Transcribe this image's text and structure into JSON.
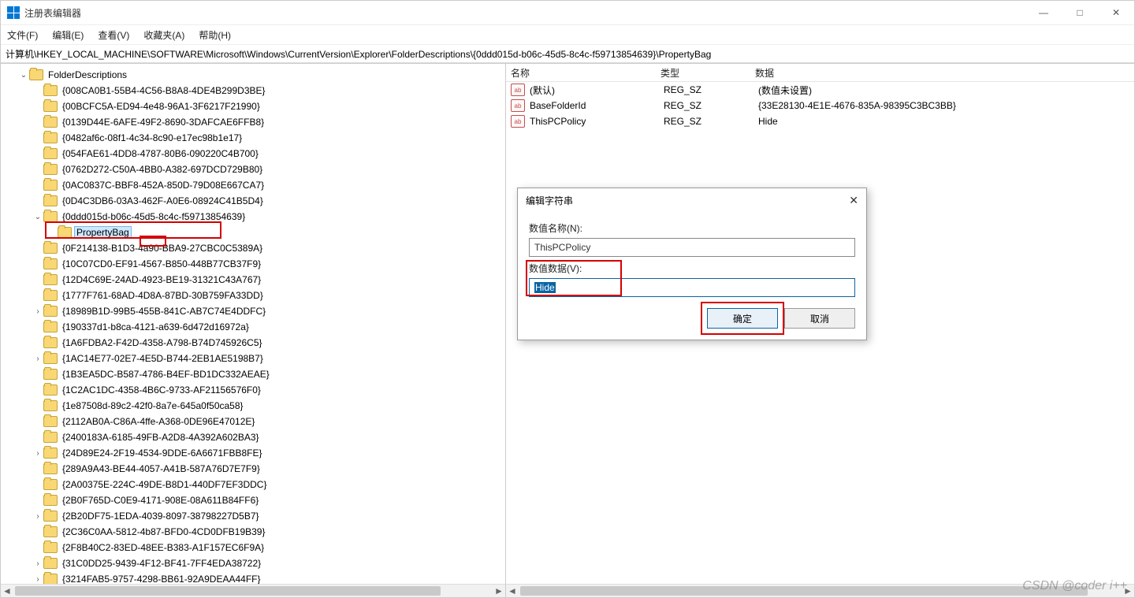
{
  "window": {
    "title": "注册表编辑器",
    "controls": {
      "min": "—",
      "max": "□",
      "close": "✕"
    }
  },
  "menu": {
    "file": "文件(F)",
    "edit": "编辑(E)",
    "view": "查看(V)",
    "fav": "收藏夹(A)",
    "help": "帮助(H)"
  },
  "addressbar": "计算机\\HKEY_LOCAL_MACHINE\\SOFTWARE\\Microsoft\\Windows\\CurrentVersion\\Explorer\\FolderDescriptions\\{0ddd015d-b06c-45d5-8c4c-f59713854639}\\PropertyBag",
  "tree": {
    "root": "FolderDescriptions",
    "expanded": "{0ddd015d-b06c-45d5-8c4c-f59713854639}",
    "selected": "PropertyBag",
    "items": [
      {
        "t": "{008CA0B1-55B4-4C56-B8A8-4DE4B299D3BE}"
      },
      {
        "t": "{00BCFC5A-ED94-4e48-96A1-3F6217F21990}"
      },
      {
        "t": "{0139D44E-6AFE-49F2-8690-3DAFCAE6FFB8}"
      },
      {
        "t": "{0482af6c-08f1-4c34-8c90-e17ec98b1e17}"
      },
      {
        "t": "{054FAE61-4DD8-4787-80B6-090220C4B700}"
      },
      {
        "t": "{0762D272-C50A-4BB0-A382-697DCD729B80}"
      },
      {
        "t": "{0AC0837C-BBF8-452A-850D-79D08E667CA7}"
      },
      {
        "t": "{0D4C3DB6-03A3-462F-A0E6-08924C41B5D4}"
      },
      {
        "t": "{0ddd015d-b06c-45d5-8c4c-f59713854639}",
        "open": true,
        "child": "PropertyBag"
      },
      {
        "t": "{0F214138-B1D3-4a90-BBA9-27CBC0C5389A}"
      },
      {
        "t": "{10C07CD0-EF91-4567-B850-448B77CB37F9}"
      },
      {
        "t": "{12D4C69E-24AD-4923-BE19-31321C43A767}"
      },
      {
        "t": "{1777F761-68AD-4D8A-87BD-30B759FA33DD}"
      },
      {
        "t": "{18989B1D-99B5-455B-841C-AB7C74E4DDFC}",
        "exp": true
      },
      {
        "t": "{190337d1-b8ca-4121-a639-6d472d16972a}"
      },
      {
        "t": "{1A6FDBA2-F42D-4358-A798-B74D745926C5}"
      },
      {
        "t": "{1AC14E77-02E7-4E5D-B744-2EB1AE5198B7}",
        "exp": true
      },
      {
        "t": "{1B3EA5DC-B587-4786-B4EF-BD1DC332AEAE}"
      },
      {
        "t": "{1C2AC1DC-4358-4B6C-9733-AF21156576F0}"
      },
      {
        "t": "{1e87508d-89c2-42f0-8a7e-645a0f50ca58}"
      },
      {
        "t": "{2112AB0A-C86A-4ffe-A368-0DE96E47012E}"
      },
      {
        "t": "{2400183A-6185-49FB-A2D8-4A392A602BA3}"
      },
      {
        "t": "{24D89E24-2F19-4534-9DDE-6A6671FBB8FE}",
        "exp": true
      },
      {
        "t": "{289A9A43-BE44-4057-A41B-587A76D7E7F9}"
      },
      {
        "t": "{2A00375E-224C-49DE-B8D1-440DF7EF3DDC}"
      },
      {
        "t": "{2B0F765D-C0E9-4171-908E-08A611B84FF6}"
      },
      {
        "t": "{2B20DF75-1EDA-4039-8097-38798227D5B7}",
        "exp": true
      },
      {
        "t": "{2C36C0AA-5812-4b87-BFD0-4CD0DFB19B39}"
      },
      {
        "t": "{2F8B40C2-83ED-48EE-B383-A1F157EC6F9A}"
      },
      {
        "t": "{31C0DD25-9439-4F12-BF41-7FF4EDA38722}",
        "exp": true
      },
      {
        "t": "{3214FAB5-9757-4298-BB61-92A9DEAA44FF}",
        "exp": true
      }
    ]
  },
  "columns": {
    "name": "名称",
    "type": "类型",
    "data": "数据"
  },
  "values": [
    {
      "name": "(默认)",
      "type": "REG_SZ",
      "data": "(数值未设置)"
    },
    {
      "name": "BaseFolderId",
      "type": "REG_SZ",
      "data": "{33E28130-4E1E-4676-835A-98395C3BC3BB}"
    },
    {
      "name": "ThisPCPolicy",
      "type": "REG_SZ",
      "data": "Hide"
    }
  ],
  "dialog": {
    "title": "编辑字符串",
    "name_label": "数值名称(N):",
    "name_value": "ThisPCPolicy",
    "data_label": "数值数据(V):",
    "data_value": "Hide",
    "ok": "确定",
    "cancel": "取消"
  },
  "watermark": "CSDN @coder i++"
}
